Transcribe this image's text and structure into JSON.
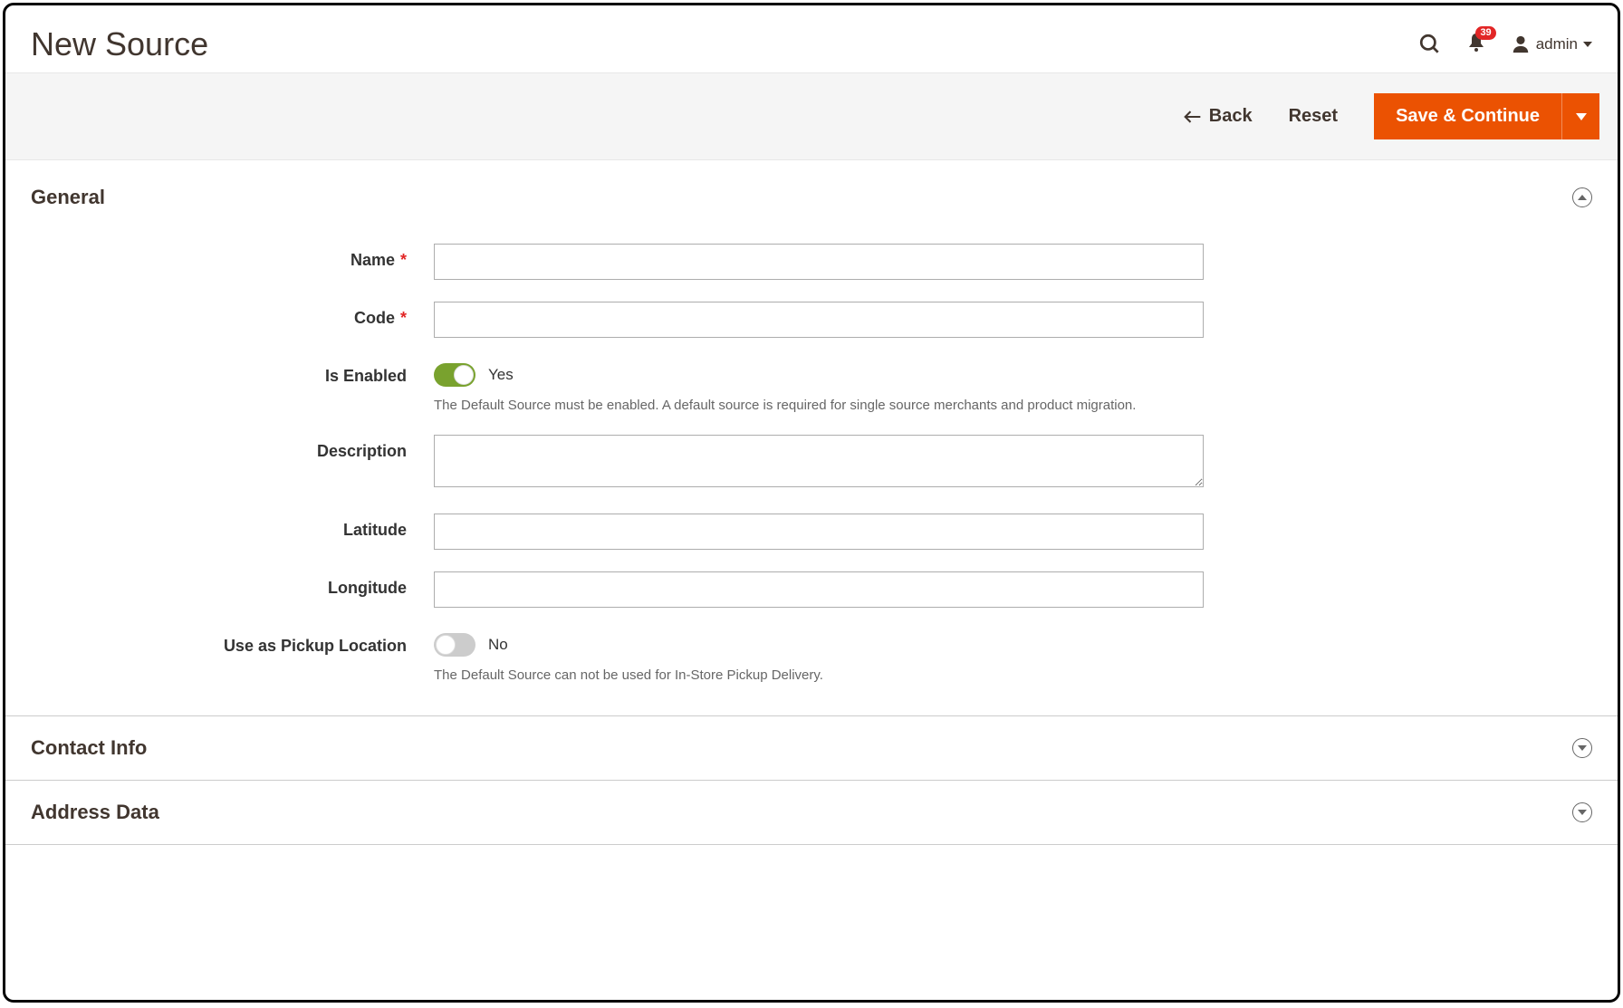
{
  "header": {
    "page_title": "New Source",
    "notification_count": "39",
    "username": "admin"
  },
  "actions": {
    "back_label": "Back",
    "reset_label": "Reset",
    "save_continue_label": "Save & Continue"
  },
  "sections": {
    "general": {
      "title": "General",
      "name_label": "Name",
      "code_label": "Code",
      "is_enabled_label": "Is Enabled",
      "is_enabled_value": "Yes",
      "is_enabled_note": "The Default Source must be enabled. A default source is required for single source merchants and product migration.",
      "description_label": "Description",
      "latitude_label": "Latitude",
      "longitude_label": "Longitude",
      "pickup_label": "Use as Pickup Location",
      "pickup_value": "No",
      "pickup_note": "The Default Source can not be used for In-Store Pickup Delivery."
    },
    "contact_info": {
      "title": "Contact Info"
    },
    "address_data": {
      "title": "Address Data"
    }
  }
}
